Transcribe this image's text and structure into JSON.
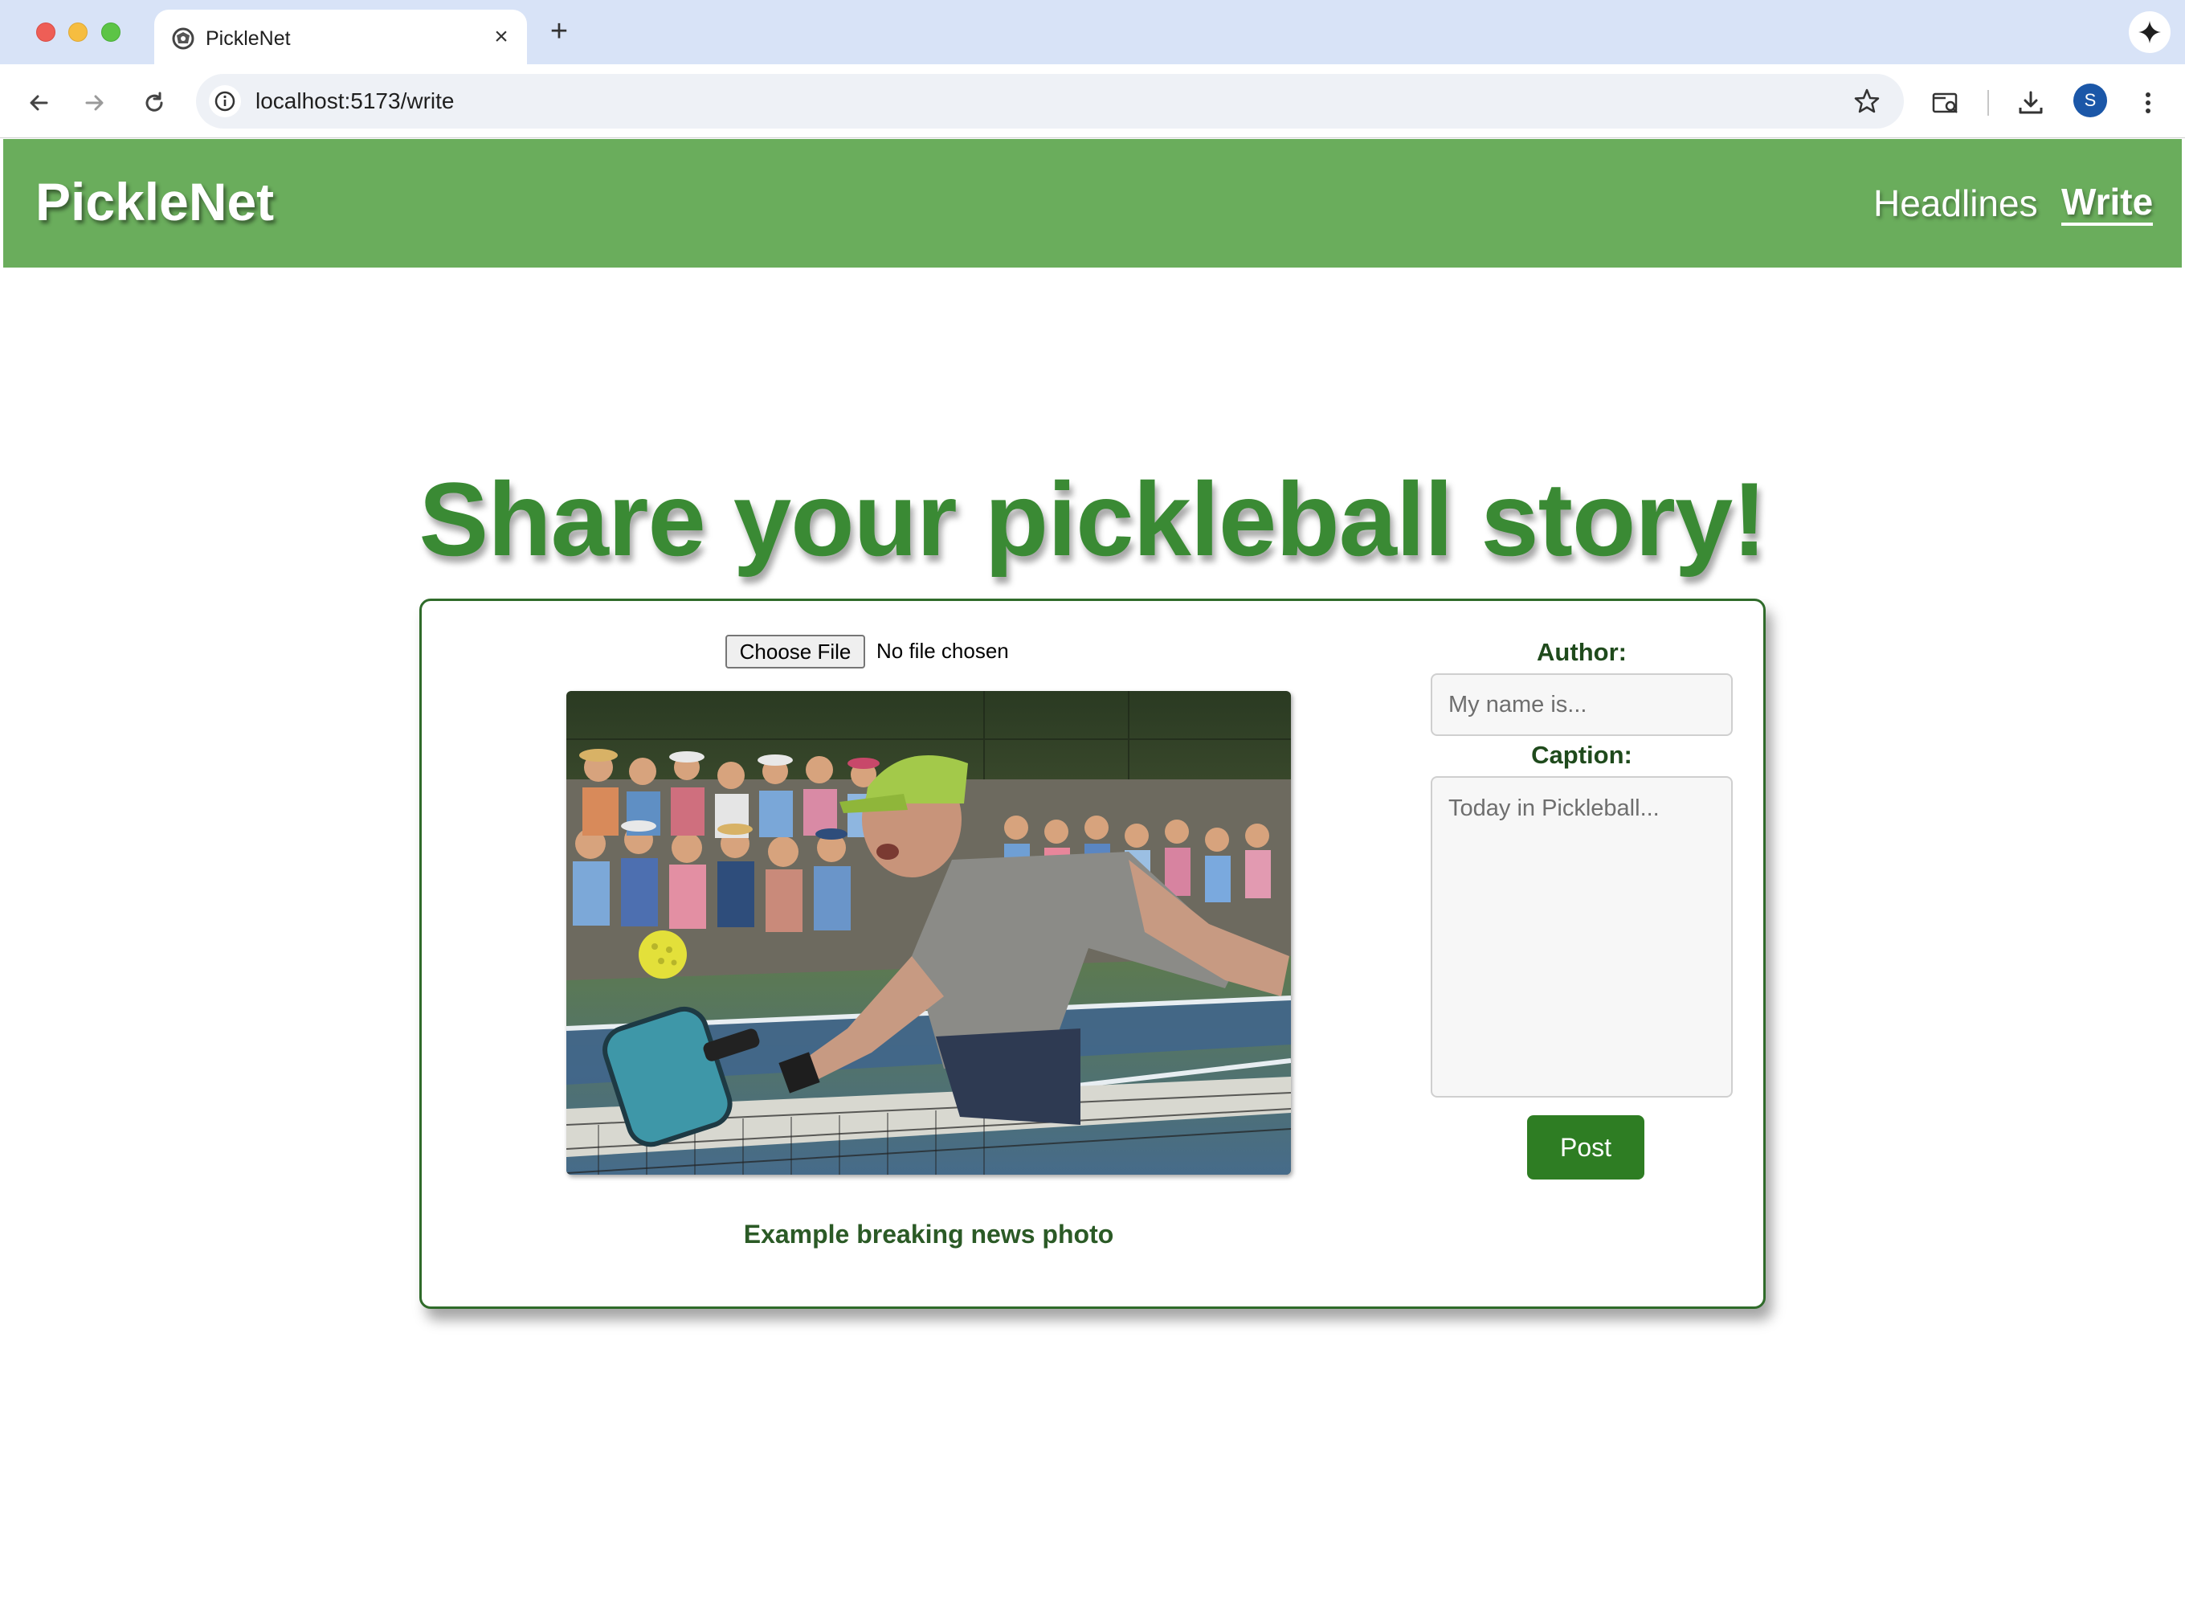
{
  "browser": {
    "tab_title": "PickleNet",
    "url": "localhost:5173/write",
    "profile_initial": "S",
    "icons": [
      "close-icon",
      "plus-icon",
      "gemini-icon",
      "back-arrow-icon",
      "forward-arrow-icon",
      "reload-icon",
      "site-info-icon",
      "bookmark-star-icon",
      "tab-search-icon",
      "download-icon",
      "kebab-menu-icon"
    ]
  },
  "header": {
    "brand": "PickleNet",
    "nav": [
      {
        "label": "Headlines",
        "active": false
      },
      {
        "label": "Write",
        "active": true
      }
    ],
    "color": "#6aad5c"
  },
  "main": {
    "title": "Share your pickleball story!",
    "file_input": {
      "button_label": "Choose File",
      "status": "No file chosen"
    },
    "photo_caption": "Example breaking news photo",
    "form": {
      "author_label": "Author:",
      "author_placeholder": "My name is...",
      "caption_label": "Caption:",
      "caption_placeholder": "Today in Pickleball...",
      "post_label": "Post"
    }
  },
  "colors": {
    "accent_green": "#3a8a34",
    "button_green": "#2e7d23",
    "card_border": "#2f6b2a"
  }
}
